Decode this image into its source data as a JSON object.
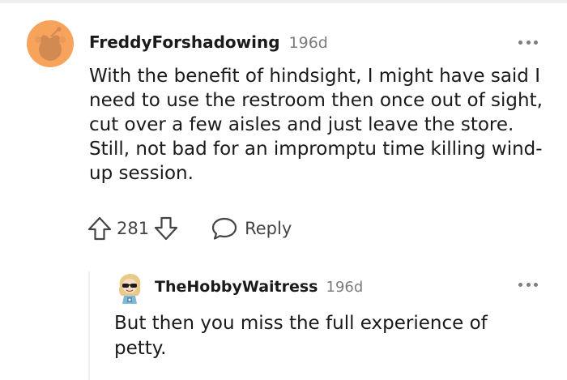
{
  "colors": {
    "username": "#1a1a1b",
    "meta": "#7c7c7c",
    "body_text": "#1a1a1b",
    "avatar_bg": "#f7a35c",
    "thread_line": "#edeff1"
  },
  "comment": {
    "username": "FreddyForshadowing",
    "age": "196d",
    "body": "With the benefit of hindsight, I might have said I need to use the restroom then once out of sight, cut over a few aisles and just leave the store. Still, not bad for an impromptu time killing wind-up session.",
    "score": "281",
    "reply_label": "Reply",
    "avatar_icon": "snoo-avatar",
    "more_icon": "more-dots-icon"
  },
  "reply": {
    "username": "TheHobbyWaitress",
    "age": "196d",
    "body": "But then you miss the full experience of petty.",
    "avatar_icon": "cartoon-avatar-sunglasses",
    "more_icon": "more-dots-icon"
  }
}
